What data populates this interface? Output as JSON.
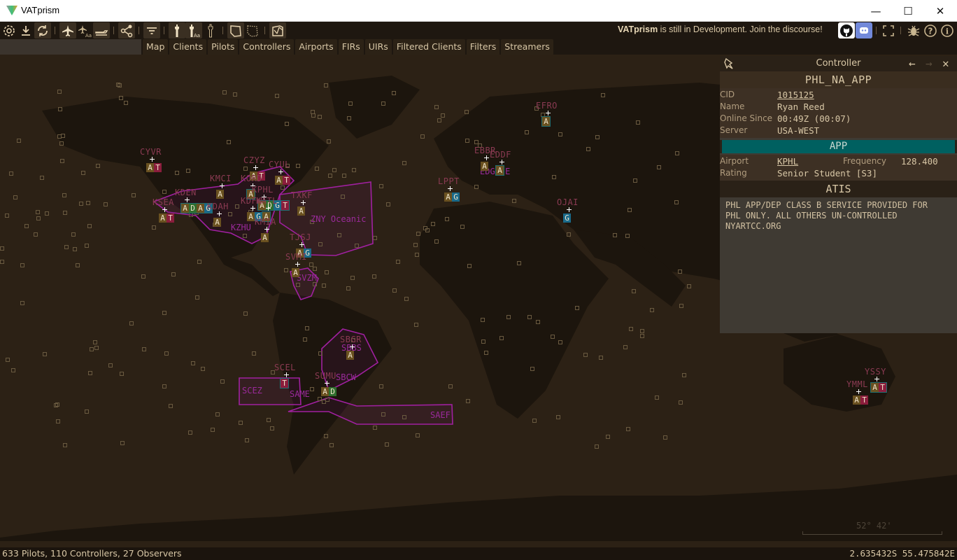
{
  "window": {
    "title": "VATprism",
    "controls": {
      "minimize": "—",
      "maximize": "☐",
      "close": "✕"
    }
  },
  "toolbar": {
    "buttons": [
      {
        "icon": "gear-icon",
        "active": false
      },
      {
        "icon": "download-icon",
        "active": false
      },
      {
        "icon": "refresh-icon",
        "active": true
      },
      {
        "icon": "plane-icon",
        "active": true
      },
      {
        "icon": "plane-label-icon",
        "active": false
      },
      {
        "icon": "plane-ground-icon",
        "active": true
      },
      {
        "icon": "share-icon",
        "active": true
      },
      {
        "icon": "filter-icon",
        "active": true
      },
      {
        "icon": "tower-icon",
        "active": true
      },
      {
        "icon": "tower-label-icon",
        "active": true
      },
      {
        "icon": "tower-outline-icon",
        "active": false
      },
      {
        "icon": "fir-icon",
        "active": true
      },
      {
        "icon": "uir-dotted-icon",
        "active": false
      },
      {
        "icon": "map-icon",
        "active": true
      }
    ],
    "banner_bold": "VATprism",
    "banner_text": " is still in Development. Join the discourse!",
    "right_icons": [
      "github-icon",
      "discord-icon",
      "fullscreen-icon",
      "bug-icon",
      "help-icon",
      "info-icon"
    ]
  },
  "search": {
    "placeholder": "",
    "value": ""
  },
  "tabs": [
    "Map",
    "Clients",
    "Pilots",
    "Controllers",
    "Airports",
    "FIRs",
    "UIRs",
    "Filtered Clients",
    "Filters",
    "Streamers"
  ],
  "map": {
    "stations": [
      {
        "label": "CYVR",
        "badges": [
          "A",
          "T"
        ],
        "boxed": false
      },
      {
        "label": "KSEA",
        "badges": [
          "A",
          "T"
        ],
        "boxed": false
      },
      {
        "label": "KDEN",
        "badges": [
          "A",
          "D",
          "A",
          "G"
        ],
        "boxed": true
      },
      {
        "label": "KMCI",
        "badges": [
          "A"
        ],
        "boxed": false
      },
      {
        "label": "CZYZ",
        "badges": [
          "A",
          "T"
        ],
        "boxed": false
      },
      {
        "label": "CYUL",
        "badges": [
          "A",
          "T"
        ],
        "boxed": false
      },
      {
        "label": "KORD",
        "badges": [
          "A"
        ],
        "boxed": true
      },
      {
        "label": "KPHL",
        "badges": [
          "A",
          "D",
          "G",
          "T"
        ],
        "boxed": true
      },
      {
        "label": "KDFW",
        "badges": [
          "A",
          "G"
        ],
        "boxed": false
      },
      {
        "label": "KATL",
        "badges": [
          "A"
        ],
        "boxed": true
      },
      {
        "label": "KDAH",
        "badges": [
          "A"
        ],
        "boxed": false
      },
      {
        "label": "KMIA",
        "badges": [
          "A"
        ],
        "boxed": false
      },
      {
        "label": "TXKF",
        "badges": [
          "A"
        ],
        "boxed": false
      },
      {
        "label": "TJSJ",
        "badges": [
          "A",
          "G"
        ],
        "boxed": false
      },
      {
        "label": "SVMI",
        "badges": [
          "A"
        ],
        "boxed": false
      },
      {
        "label": "EFRO",
        "badges": [
          "A"
        ],
        "boxed": true
      },
      {
        "label": "EBBR",
        "badges": [
          "A"
        ],
        "boxed": false
      },
      {
        "label": "EDDF",
        "badges": [
          "A"
        ],
        "boxed": true
      },
      {
        "label": "LPPT",
        "badges": [
          "A",
          "G"
        ],
        "boxed": false
      },
      {
        "label": "OJAI",
        "badges": [
          "G"
        ],
        "boxed": false
      },
      {
        "label": "SBGR",
        "badges": [
          "A"
        ],
        "boxed": false
      },
      {
        "label": "SCEL",
        "badges": [
          "T"
        ],
        "boxed": true
      },
      {
        "label": "SUMU",
        "badges": [
          "A",
          "D"
        ],
        "boxed": false
      },
      {
        "label": "YSSY",
        "badges": [
          "A",
          "T"
        ],
        "boxed": true
      },
      {
        "label": "YMML",
        "badges": [
          "A",
          "T"
        ],
        "boxed": false
      }
    ],
    "fir_labels": [
      "ZNY Oceanic",
      "SCEZ",
      "SAEF",
      "SBCW",
      "SBBS",
      "SAME",
      "SVZM",
      "KZHU",
      "EDGG-E"
    ],
    "scale_label": "52° 42'"
  },
  "panel": {
    "title": "Controller",
    "callsign": "PHL_NA_APP",
    "fields": {
      "cid_label": "CID",
      "cid": "1015125",
      "name_label": "Name",
      "name": "Ryan Reed",
      "online_label": "Online Since",
      "online": "00:49Z (00:07)",
      "server_label": "Server",
      "server": "USA-WEST"
    },
    "facility": "APP",
    "facility_color": "#006060",
    "airport_label": "Airport",
    "airport": "KPHL",
    "frequency_label": "Frequency",
    "frequency": "128.400",
    "rating_label": "Rating",
    "rating": "Senior Student [S3]",
    "atis_title": "ATIS",
    "atis_text": "PHL APP/DEP CLASS B SERVICE PROVIDED FOR\nPHL ONLY. ALL OTHERS UN-CONTROLLED\nNYARTCC.ORG"
  },
  "status": {
    "counts": "633 Pilots, 110 Controllers, 27 Observers",
    "coords": "2.635432S 55.475842E"
  }
}
